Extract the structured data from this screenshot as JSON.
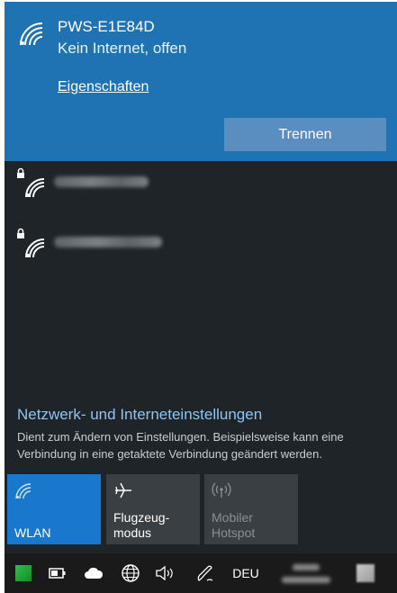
{
  "wifi_panel": {
    "connected": {
      "ssid": "PWS-E1E84D",
      "status": "Kein Internet, offen",
      "properties_link": "Eigenschaften",
      "disconnect_button": "Trennen"
    },
    "networks": [
      {
        "icon": "secured-wifi-icon",
        "name_visible": false
      },
      {
        "icon": "secured-wifi-icon",
        "name_visible": false
      }
    ],
    "settings": {
      "title": "Netzwerk- und Interneteinstellungen",
      "description": "Dient zum Ändern von Einstellungen. Beispielsweise kann eine Verbindung in eine getaktete Verbindung geändert werden."
    },
    "quick_actions": [
      {
        "label": "WLAN",
        "icon": "wifi-icon",
        "state": "on"
      },
      {
        "label": "Flugzeug-\nmodus",
        "icon": "airplane-icon",
        "state": "off"
      },
      {
        "label": "Mobiler\nHotspot",
        "icon": "hotspot-icon",
        "state": "disabled"
      }
    ]
  },
  "taskbar": {
    "tray_icons": [
      "app-icon",
      "battery-icon",
      "cloud-icon",
      "network-globe-icon",
      "volume-icon",
      "pen-icon"
    ],
    "language": "DEU"
  },
  "colors": {
    "panel_bg": "#1f2428",
    "connected_bg": "#1f73b3",
    "accent": "#1a78cc",
    "link": "#8fc4f2"
  }
}
